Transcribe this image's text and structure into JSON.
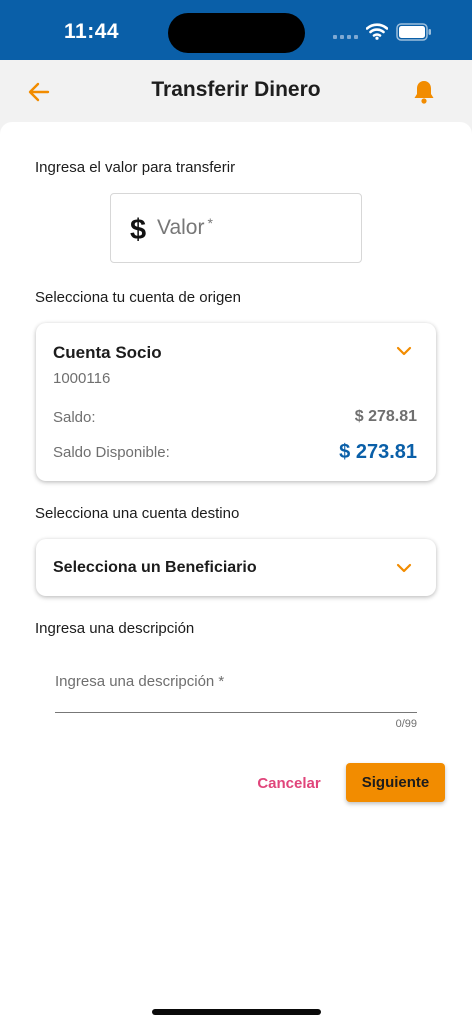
{
  "status_bar": {
    "time": "11:44"
  },
  "nav": {
    "title": "Transferir Dinero"
  },
  "amount": {
    "label": "Ingresa el valor para transferir",
    "currency_symbol": "$",
    "placeholder": "Valor",
    "required_mark": "*"
  },
  "origin": {
    "label": "Selecciona tu cuenta de origen",
    "account_name": "Cuenta Socio",
    "account_number": "1000116",
    "balance_label": "Saldo:",
    "balance_value": "$ 278.81",
    "available_label": "Saldo Disponible:",
    "available_value": "$ 273.81"
  },
  "destination": {
    "label": "Selecciona una cuenta destino",
    "select_text": "Selecciona un Beneficiario"
  },
  "description": {
    "label": "Ingresa una descripción",
    "placeholder": "Ingresa una descripción *",
    "char_count": "0/99"
  },
  "actions": {
    "cancel_label": "Cancelar",
    "next_label": "Siguiente"
  },
  "icons": {
    "back": "arrow-left-icon",
    "notifications": "bell-icon",
    "dropdown": "chevron-down-icon",
    "wifi": "wifi-icon",
    "battery": "battery-icon",
    "signal": "signal-icon"
  },
  "colors": {
    "header_blue": "#0a5fa8",
    "accent_orange": "#f28c00",
    "cancel_pink": "#e0457b",
    "available_blue": "#0a5fa8"
  }
}
